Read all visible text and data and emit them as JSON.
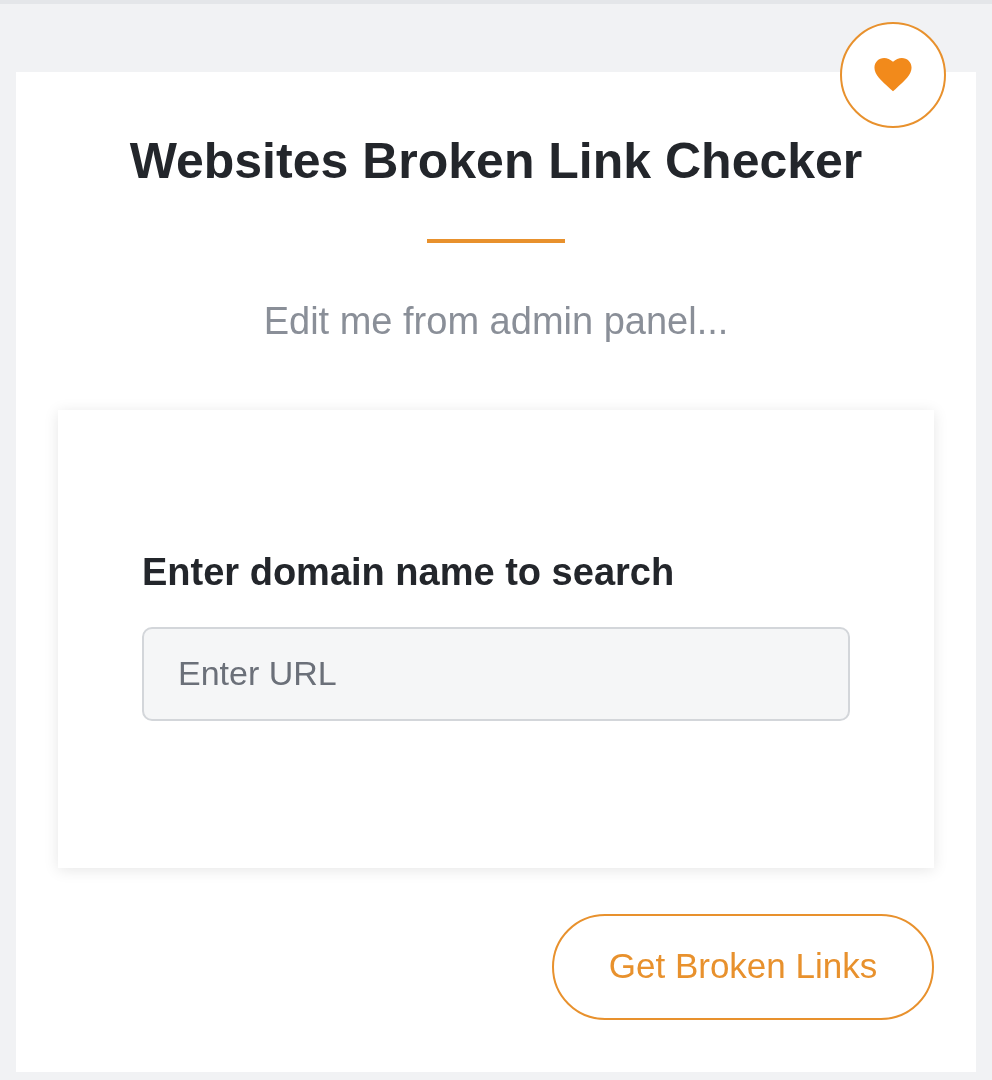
{
  "header": {
    "title": "Websites Broken Link Checker",
    "subtitle": "Edit me from admin panel..."
  },
  "form": {
    "label": "Enter domain name to search",
    "url_field": {
      "placeholder": "Enter URL"
    }
  },
  "submit_button": {
    "label": "Get Broken Links"
  }
}
